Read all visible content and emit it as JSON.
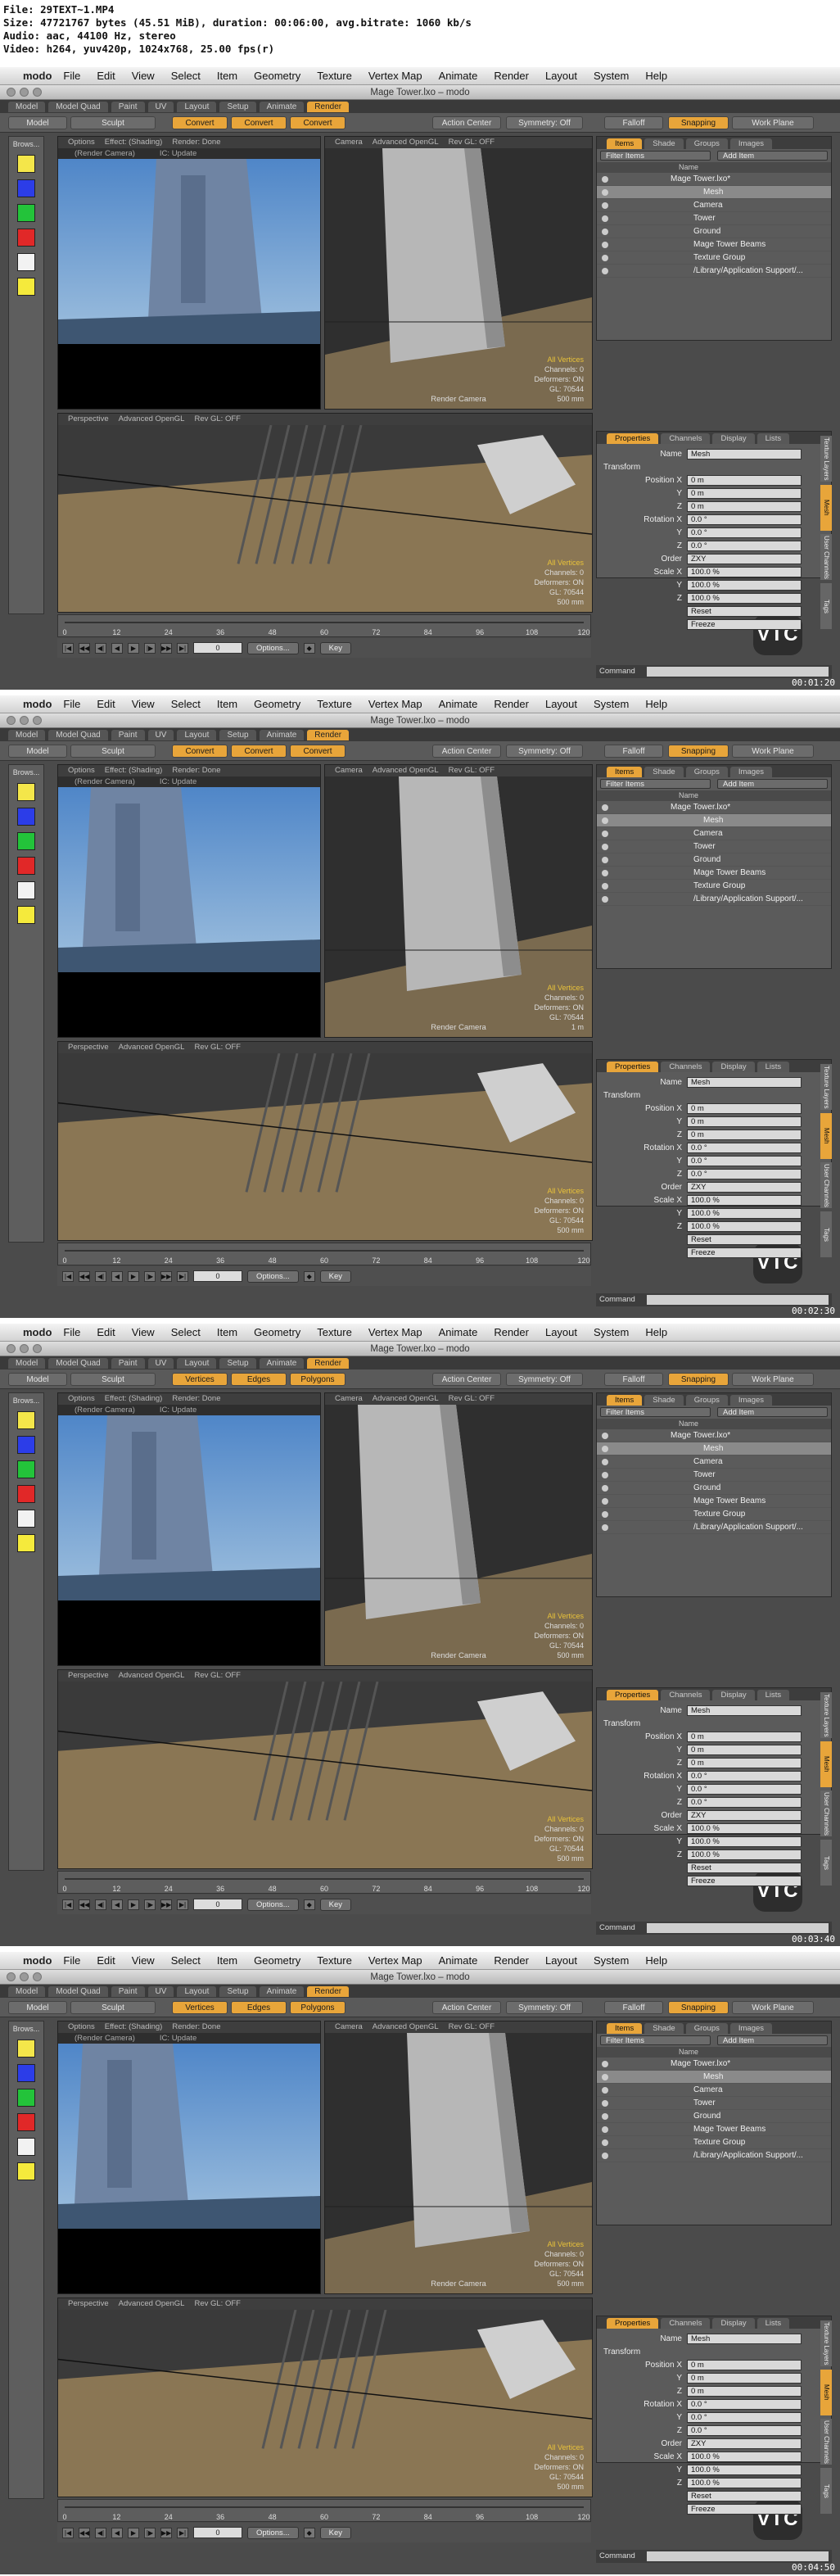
{
  "header": {
    "line1": "File: 29TEXT~1.MP4",
    "line2": "Size: 47721767 bytes (45.51 MiB), duration: 00:06:00, avg.bitrate: 1060 kb/s",
    "line3": "Audio: aac, 44100 Hz, stereo",
    "line4": "Video: h264, yuv420p, 1024x768, 25.00 fps(r)"
  },
  "app": {
    "name": "modo",
    "window_title": "Mage Tower.lxo – modo",
    "menu": [
      "File",
      "Edit",
      "View",
      "Select",
      "Item",
      "Geometry",
      "Texture",
      "Vertex Map",
      "Animate",
      "Render",
      "Layout",
      "System",
      "Help"
    ],
    "layout_tabs": [
      "Model",
      "Model Quad",
      "Paint",
      "UV",
      "Layout",
      "Setup",
      "Animate",
      "Render"
    ],
    "palette_label": "Brows...",
    "viewport": {
      "topbar_left": [
        "Options",
        "Effect: (Shading)",
        "Render: Done"
      ],
      "infobar_left": [
        "(Render Camera)",
        "IC: Update"
      ],
      "topbar_right": [
        "Camera",
        "Advanced OpenGL",
        "Rev GL: OFF"
      ],
      "topbar_bottom": [
        "Perspective",
        "Advanced OpenGL",
        "Rev GL: OFF"
      ],
      "camera_label": "Render Camera"
    },
    "timeline_ticks": [
      "0",
      "12",
      "24",
      "36",
      "48",
      "60",
      "72",
      "84",
      "96",
      "108",
      "120"
    ],
    "transport": {
      "frame": "0",
      "options": "Options...",
      "key": "Key"
    },
    "items_panel": {
      "tabs": [
        "Items",
        "Shade",
        "Groups",
        "Images"
      ],
      "filter": "Filter Items",
      "add": "Add Item",
      "col_name": "Name",
      "rows": [
        "Mage Tower.lxo*",
        "Mesh",
        "Camera",
        "Tower",
        "Ground",
        "Mage Tower Beams",
        "Texture Group",
        "/Library/Application Support/..."
      ]
    },
    "props_panel": {
      "tabs": [
        "Properties",
        "Channels",
        "Display",
        "Lists"
      ],
      "name_label": "Name",
      "name_value": "Mesh",
      "transform": "Transform",
      "rows": [
        {
          "label": "Position X",
          "value": "0 m"
        },
        {
          "label": "Y",
          "value": "0 m"
        },
        {
          "label": "Z",
          "value": "0 m"
        },
        {
          "label": "Rotation X",
          "value": "0.0 °"
        },
        {
          "label": "Y",
          "value": "0.0 °"
        },
        {
          "label": "Z",
          "value": "0.0 °"
        },
        {
          "label": "Order",
          "value": "ZXY"
        },
        {
          "label": "Scale X",
          "value": "100.0 %"
        },
        {
          "label": "Y",
          "value": "100.0 %"
        },
        {
          "label": "Z",
          "value": "100.0 %"
        },
        {
          "label": "",
          "value": "Reset"
        },
        {
          "label": "",
          "value": "Freeze"
        }
      ],
      "side_tabs": [
        "Texture Layers",
        "Mesh",
        "User Channels",
        "Tags"
      ]
    },
    "command_label": "Command",
    "logo": "VTC",
    "colors": {
      "accent": "#e8a53a",
      "swatches": [
        "#f4e64a",
        "#2c3de8",
        "#23c33a",
        "#e12828",
        "#f2f2f2",
        "#f5ea3c"
      ]
    }
  },
  "frames": [
    {
      "timestamp": "00:01:20",
      "tool_buttons": [
        "Model",
        "Sculpt",
        "Convert",
        "Convert",
        "Convert",
        "Action Center",
        "Symmetry: Off",
        "Falloff",
        "Snapping",
        "Work Plane"
      ],
      "top_right_stats": [
        "All Vertices",
        "Channels: 0",
        "Deformers: ON",
        "GL: 70544",
        "500 mm"
      ],
      "bottom_stats": [
        "All Vertices",
        "Channels: 0",
        "Deformers: ON",
        "GL: 70544",
        "500 mm"
      ]
    },
    {
      "timestamp": "00:02:30",
      "tool_buttons": [
        "Model",
        "Sculpt",
        "Convert",
        "Convert",
        "Convert",
        "Action Center",
        "Symmetry: Off",
        "Falloff",
        "Snapping",
        "Work Plane"
      ],
      "top_right_stats": [
        "All Vertices",
        "Channels: 0",
        "Deformers: ON",
        "GL: 70544",
        "1 m"
      ],
      "bottom_stats": [
        "All Vertices",
        "Channels: 0",
        "Deformers: ON",
        "GL: 70544",
        "500 mm"
      ]
    },
    {
      "timestamp": "00:03:40",
      "tool_buttons": [
        "Model",
        "Sculpt",
        "Vertices",
        "Edges",
        "Polygons",
        "Action Center",
        "Symmetry: Off",
        "Falloff",
        "Snapping",
        "Work Plane"
      ],
      "top_right_stats": [
        "All Vertices",
        "Channels: 0",
        "Deformers: ON",
        "GL: 70544",
        "500 mm"
      ],
      "bottom_stats": [
        "All Vertices",
        "Channels: 0",
        "Deformers: ON",
        "GL: 70544",
        "500 mm"
      ]
    },
    {
      "timestamp": "00:04:50",
      "tool_buttons": [
        "Model",
        "Sculpt",
        "Vertices",
        "Edges",
        "Polygons",
        "Action Center",
        "Symmetry: Off",
        "Falloff",
        "Snapping",
        "Work Plane"
      ],
      "top_right_stats": [
        "All Vertices",
        "Channels: 0",
        "Deformers: ON",
        "GL: 70544",
        "500 mm"
      ],
      "bottom_stats": [
        "All Vertices",
        "Channels: 0",
        "Deformers: ON",
        "GL: 70544",
        "500 mm"
      ]
    }
  ]
}
